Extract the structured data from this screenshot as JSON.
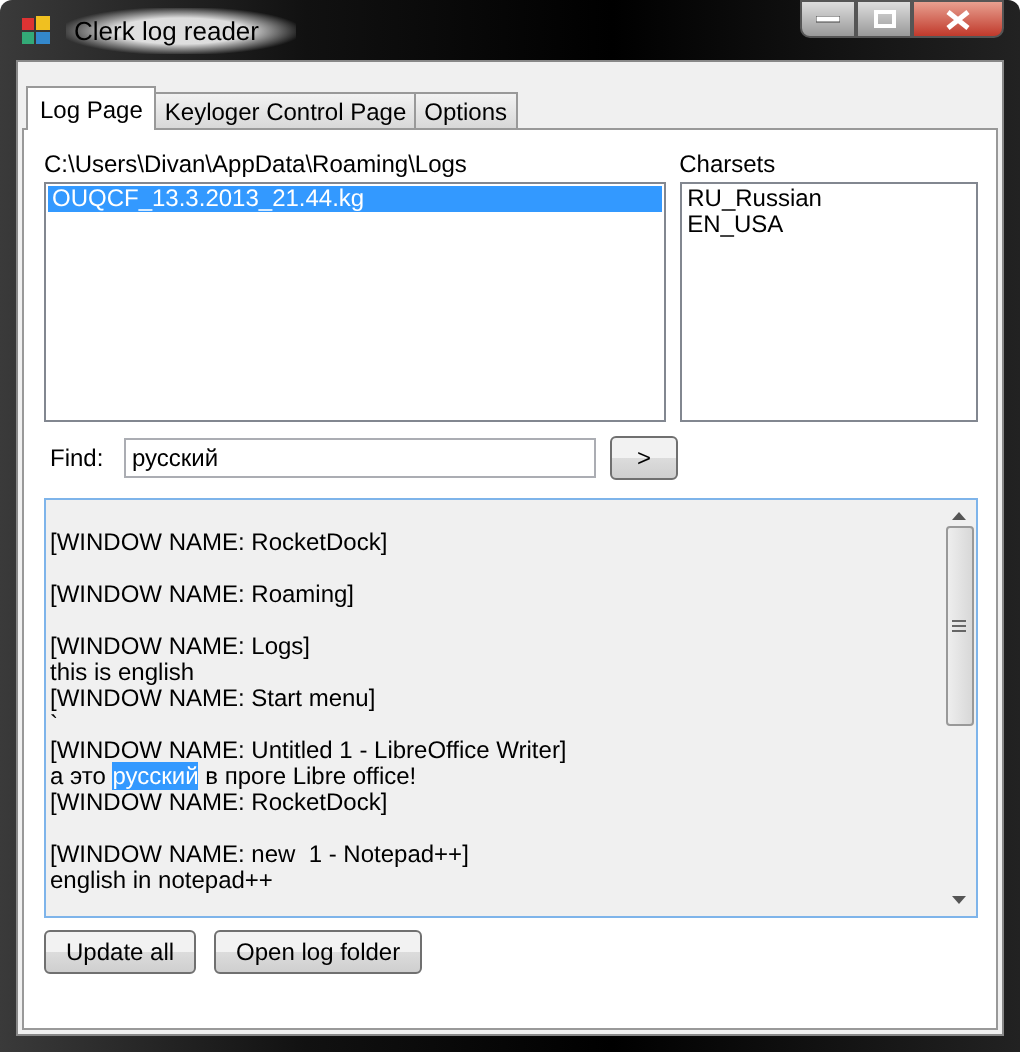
{
  "window": {
    "title": "Clerk log reader"
  },
  "tabs": [
    {
      "label": "Log Page",
      "selected": true
    },
    {
      "label": "Keyloger Control Page",
      "selected": false
    },
    {
      "label": "Options",
      "selected": false
    }
  ],
  "path_label": "C:\\Users\\Divan\\AppData\\Roaming\\Logs",
  "log_files": [
    {
      "name": "OUQCF_13.3.2013_21.44.kg",
      "selected": true
    }
  ],
  "charsets_label": "Charsets",
  "charsets": [
    {
      "name": "RU_Russian",
      "selected": false
    },
    {
      "name": "EN_USA",
      "selected": false
    }
  ],
  "find": {
    "label": "Find:",
    "value": "русский",
    "button": ">"
  },
  "log_lines": [
    {
      "space_before": true,
      "segments": [
        {
          "text": "[WINDOW NAME: RocketDock]",
          "selected": false
        }
      ]
    },
    {
      "space_before": true,
      "segments": [
        {
          "text": "[WINDOW NAME: Roaming]",
          "selected": false
        }
      ]
    },
    {
      "space_before": true,
      "segments": [
        {
          "text": "[WINDOW NAME: Logs]",
          "selected": false
        }
      ]
    },
    {
      "space_before": false,
      "segments": [
        {
          "text": "this is english",
          "selected": false
        }
      ]
    },
    {
      "space_before": false,
      "segments": [
        {
          "text": "[WINDOW NAME: Start menu]",
          "selected": false
        }
      ]
    },
    {
      "space_before": false,
      "segments": [
        {
          "text": "`",
          "selected": false
        }
      ]
    },
    {
      "space_before": false,
      "segments": [
        {
          "text": "[WINDOW NAME: Untitled 1 - LibreOffice Writer]",
          "selected": false
        }
      ]
    },
    {
      "space_before": false,
      "segments": [
        {
          "text": "а это ",
          "selected": false
        },
        {
          "text": "русский",
          "selected": true
        },
        {
          "text": " в проге Libre office!",
          "selected": false
        }
      ]
    },
    {
      "space_before": false,
      "segments": [
        {
          "text": "[WINDOW NAME: RocketDock]",
          "selected": false
        }
      ]
    },
    {
      "space_before": true,
      "segments": [
        {
          "text": "[WINDOW NAME: new  1 - Notepad++]",
          "selected": false
        }
      ]
    },
    {
      "space_before": false,
      "segments": [
        {
          "text": "english in notepad++",
          "selected": false
        }
      ]
    }
  ],
  "buttons": [
    "Update all",
    "Open log folder"
  ]
}
